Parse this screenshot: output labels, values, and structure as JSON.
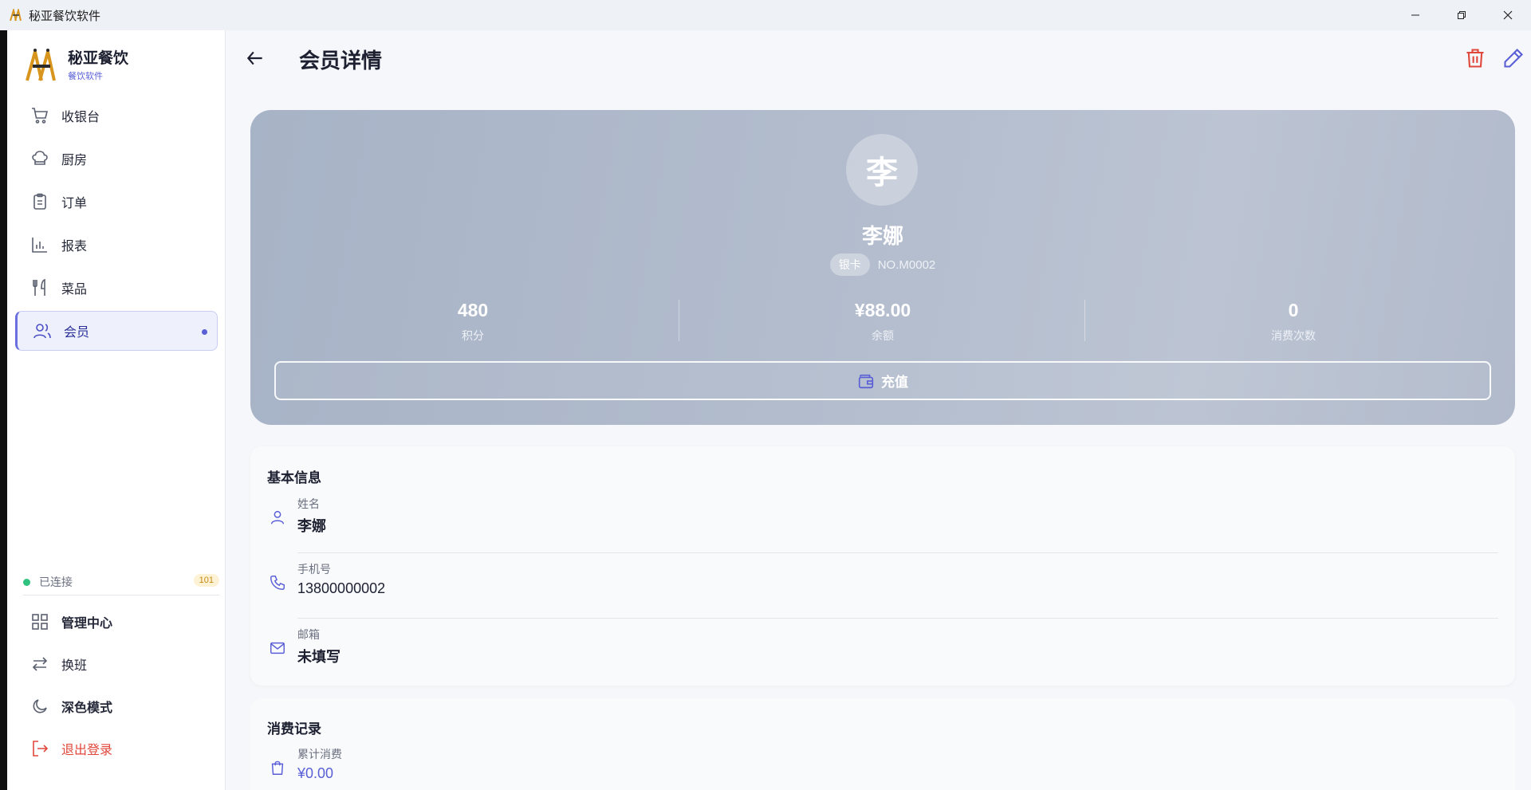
{
  "window": {
    "title": "秘亚餐饮软件",
    "controls": [
      "minimize-icon",
      "restore-icon",
      "close-icon"
    ]
  },
  "brand": {
    "name": "秘亚餐饮",
    "sub": "餐饮软件"
  },
  "nav": {
    "items": [
      {
        "label": "收银台",
        "icon": "cart-icon"
      },
      {
        "label": "厨房",
        "icon": "chef-hat-icon"
      },
      {
        "label": "订单",
        "icon": "clipboard-icon"
      },
      {
        "label": "报表",
        "icon": "bar-chart-icon"
      },
      {
        "label": "菜品",
        "icon": "utensils-icon"
      },
      {
        "label": "会员",
        "icon": "users-icon",
        "active": true
      }
    ]
  },
  "status": {
    "text": "已连接",
    "badge": "101",
    "color": "#2ec27e"
  },
  "bottom_nav": {
    "items": [
      {
        "label": "管理中心",
        "icon": "grid-icon"
      },
      {
        "label": "换班",
        "icon": "swap-icon"
      },
      {
        "label": "深色模式",
        "icon": "moon-icon"
      },
      {
        "label": "退出登录",
        "icon": "logout-icon"
      }
    ]
  },
  "header": {
    "title": "会员详情"
  },
  "member": {
    "avatar_char": "李",
    "name": "李娜",
    "tier": "银卡",
    "number": "NO.M0002",
    "stats": [
      {
        "value": "480",
        "label": "积分"
      },
      {
        "value": "¥88.00",
        "label": "余额"
      },
      {
        "value": "0",
        "label": "消费次数"
      }
    ],
    "recharge_label": "充值"
  },
  "basic_info": {
    "title": "基本信息",
    "rows": [
      {
        "label": "姓名",
        "value": "李娜",
        "icon": "user-icon"
      },
      {
        "label": "手机号",
        "value": "13800000002",
        "icon": "phone-icon"
      },
      {
        "label": "邮箱",
        "value": "未填写",
        "icon": "mail-icon"
      }
    ]
  },
  "records": {
    "title": "消费记录",
    "rows": [
      {
        "label": "累计消费",
        "value": "¥0.00",
        "icon": "shopping-bag-icon"
      }
    ]
  },
  "colors": {
    "accent": "#5a5fd6",
    "danger": "#e0473b",
    "card": "#b2bccd"
  }
}
